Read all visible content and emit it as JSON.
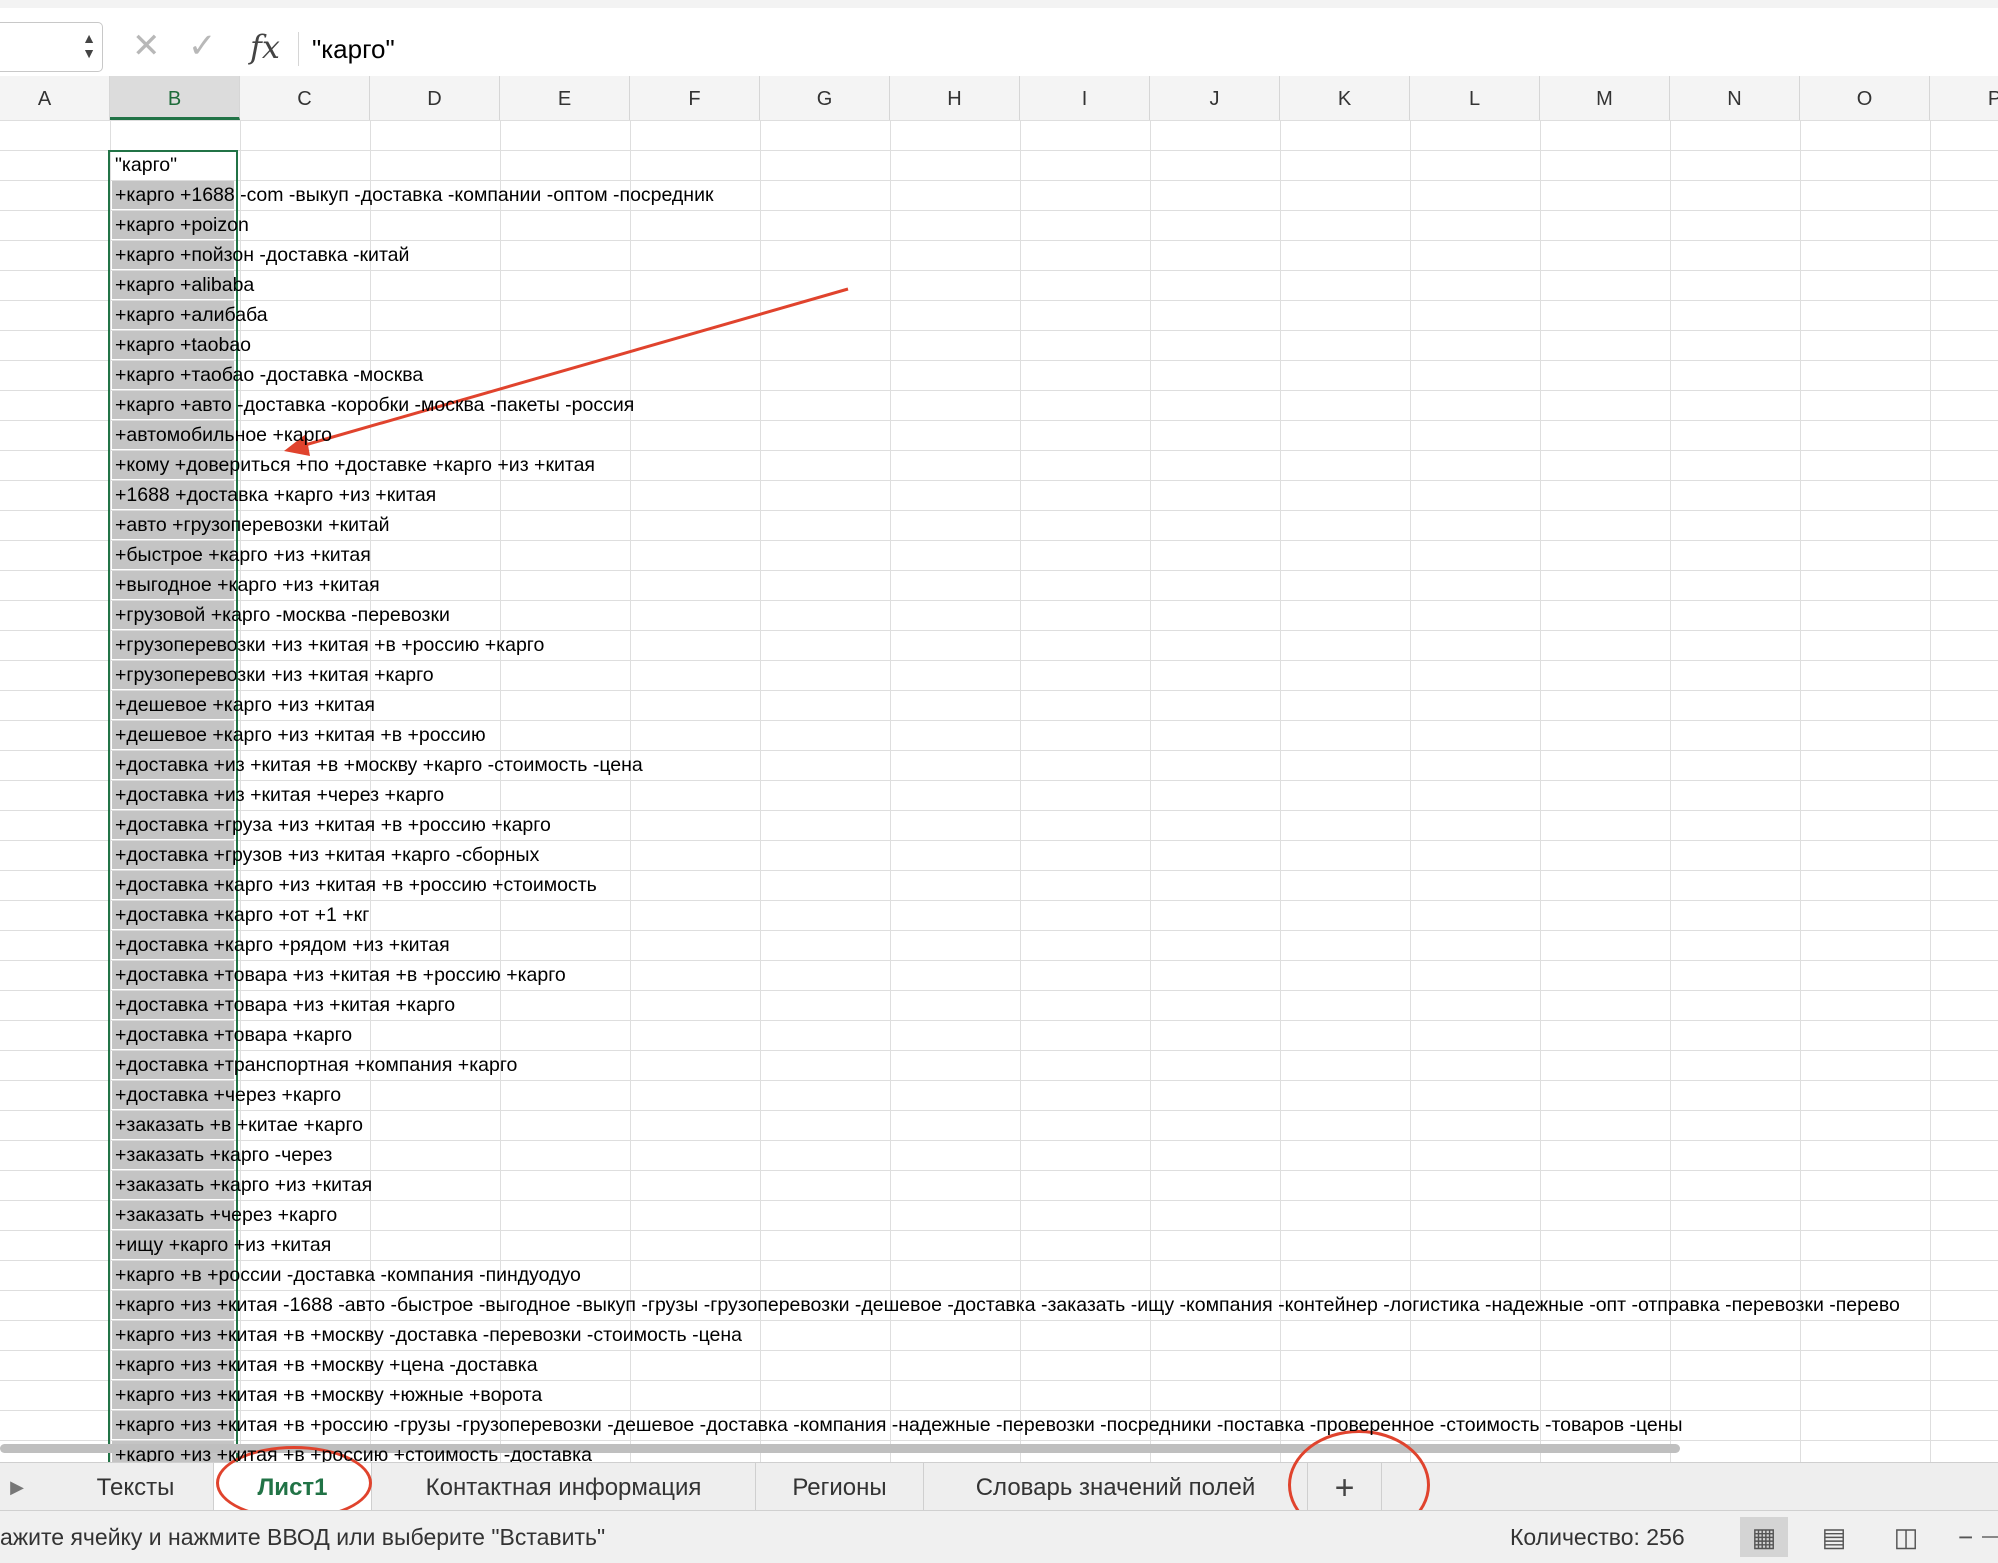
{
  "formula_bar": {
    "cancel_icon": "x-icon",
    "enter_icon": "check-icon",
    "fx_label": "fx",
    "content": "\"карго\""
  },
  "columns": [
    "A",
    "B",
    "C",
    "D",
    "E",
    "F",
    "G",
    "H",
    "I",
    "J",
    "K",
    "L",
    "M",
    "N",
    "O",
    "P"
  ],
  "selected_column": "B",
  "column_b": [
    "\"карго\"",
    "+карго +1688 -com -выкуп -доставка -компании -оптом -посредник",
    "+карго +poizon",
    "+карго +пойзон -доставка -китай",
    "+карго +alibaba",
    "+карго +алибаба",
    "+карго +taobao",
    "+карго +таобао -доставка -москва",
    "+карго +авто -доставка -коробки -москва -пакеты -россия",
    "+автомобильное +карго",
    "+кому +довериться +по +доставке +карго +из +китая",
    "+1688 +доставка +карго +из +китая",
    "+авто +грузоперевозки +китай",
    "+быстрое +карго +из +китая",
    "+выгодное +карго +из +китая",
    "+грузовой +карго -москва -перевозки",
    "+грузоперевозки +из +китая +в +россию +карго",
    "+грузоперевозки +из +китая +карго",
    "+дешевое +карго +из +китая",
    "+дешевое +карго +из +китая +в +россию",
    "+доставка +из +китая +в +москву +карго -стоимость -цена",
    "+доставка +из +китая +через +карго",
    "+доставка +груза +из +китая +в +россию +карго",
    "+доставка +грузов +из +китая +карго -сборных",
    "+доставка +карго +из +китая +в +россию +стоимость",
    "+доставка +карго +от +1 +кг",
    "+доставка +карго +рядом +из +китая",
    "+доставка +товара +из +китая +в +россию +карго",
    "+доставка +товара +из +китая +карго",
    "+доставка +товара +карго",
    "+доставка +транспортная +компания +карго",
    "+доставка +через +карго",
    "+заказать +в +китае +карго",
    "+заказать +карго -через",
    "+заказать +карго +из +китая",
    "+заказать +через +карго",
    "+ищу +карго +из +китая",
    "+карго +в +россии -доставка -компания -пиндуодуо",
    "+карго +из +китая -1688 -авто -быстрое -выгодное -выкуп -грузы -грузоперевозки -дешевое -доставка -заказать -ищу -компания -контейнер -логистика -надежные -опт -отправка -перевозки -перево",
    "+карго +из +китая +в +москву -доставка -перевозки -стоимость -цена",
    "+карго +из +китая +в +москву +цена -доставка",
    "+карго +из +китая +в +москву +южные +ворота",
    "+карго +из +китая +в +россию -грузы -грузоперевозки -дешевое -доставка -компания -надежные -перевозки -посредники -поставка -проверенное -стоимость -товаров -цены",
    "+карго +из +китая +в +россию +стоимость -доставка"
  ],
  "sheet_tabs": {
    "nav_icon": "play-icon",
    "tabs": [
      "Тексты",
      "Лист1",
      "Контактная информация",
      "Регионы",
      "Словарь значений полей"
    ],
    "active": "Лист1",
    "add_label": "+"
  },
  "status_bar": {
    "message": "ажите ячейку и нажмите ВВОД или выберите \"Вставить\"",
    "count": "Количество: 256",
    "views": [
      "normal-view-icon",
      "page-layout-icon",
      "page-break-icon"
    ],
    "zoom_minus": "−"
  },
  "annotation_color": "#e0432d",
  "accent_color": "#217346"
}
